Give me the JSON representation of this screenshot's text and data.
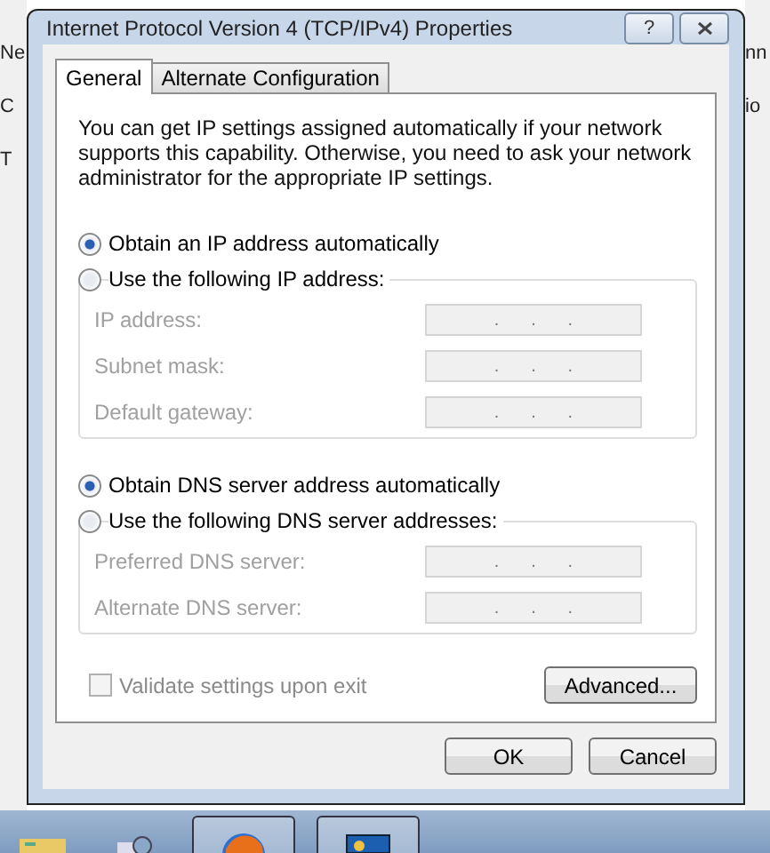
{
  "background_window": {
    "left_fragments": [
      "Ne",
      "C",
      "T"
    ],
    "right_fragments": [
      "nn",
      "io"
    ]
  },
  "dialog": {
    "title": "Internet Protocol Version 4 (TCP/IPv4) Properties",
    "help_button": "?"
  },
  "tabs": [
    {
      "label": "General",
      "selected": true
    },
    {
      "label": "Alternate Configuration",
      "selected": false
    }
  ],
  "intro": "You can get IP settings assigned automatically if your network supports this capability. Otherwise, you need to ask your network administrator for the appropriate IP settings.",
  "groups": [
    {
      "auto_option": {
        "label": "Obtain an IP address automatically",
        "selected": true
      },
      "manual_option": {
        "label": "Use the following IP address:",
        "selected": false
      },
      "fields": [
        {
          "label": "IP address:",
          "disabled": true,
          "separator": "."
        },
        {
          "label": "Subnet mask:",
          "disabled": true,
          "separator": "."
        },
        {
          "label": "Default gateway:",
          "disabled": true,
          "separator": "."
        }
      ]
    },
    {
      "auto_option": {
        "label": "Obtain DNS server address automatically",
        "selected": true
      },
      "manual_option": {
        "label": "Use the following DNS server addresses:",
        "selected": false
      },
      "fields": [
        {
          "label": "Preferred DNS server:",
          "disabled": true,
          "separator": "."
        },
        {
          "label": "Alternate DNS server:",
          "disabled": true,
          "separator": "."
        }
      ]
    }
  ],
  "validate": {
    "label": "Validate settings upon exit",
    "checked": false,
    "disabled": true
  },
  "advanced_button": "Advanced...",
  "buttons": [
    "OK",
    "Cancel"
  ],
  "taskbar": {
    "items": [
      {
        "kind": "folder",
        "active": false
      },
      {
        "kind": "network",
        "active": false
      },
      {
        "kind": "browser",
        "active": true
      },
      {
        "kind": "window",
        "active": true
      }
    ]
  }
}
